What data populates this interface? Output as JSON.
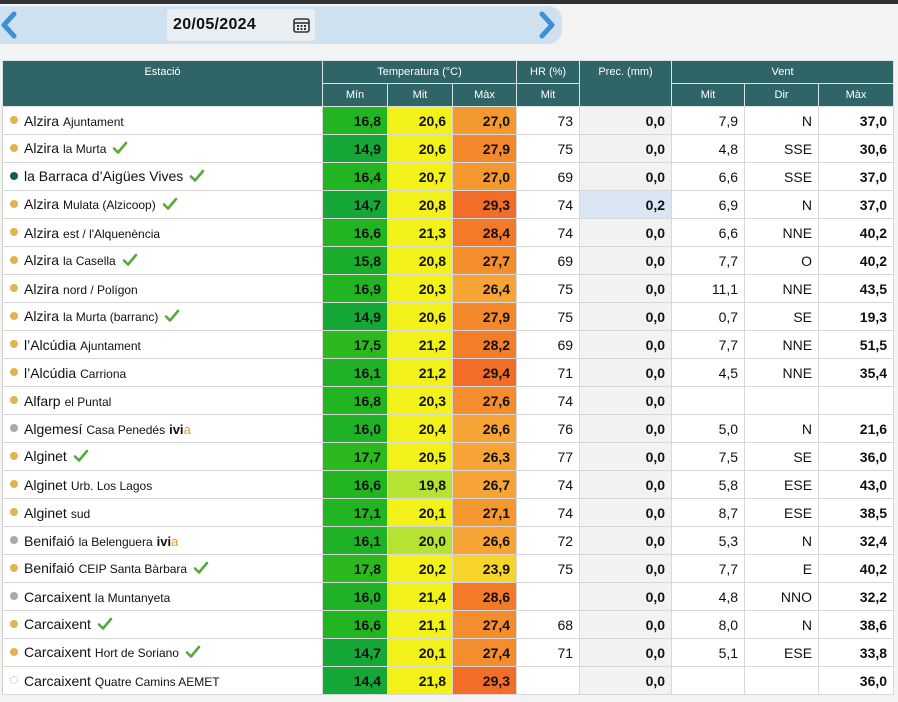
{
  "date": "20/05/2024",
  "colors": {
    "dot_yellow": "#e0b54a",
    "dot_teal": "#165c5b",
    "dot_gray": "#a8a8a8",
    "dot_white": "#ffffff",
    "check": "#58a83a",
    "header_bg": "#2f6566",
    "arrow": "#3c8fd8"
  },
  "header": {
    "estacio": "Estació",
    "temperatura": "Temperatura (°C)",
    "hr": "HR (%)",
    "prec": "Prec. (mm)",
    "vent": "Vent",
    "min": "Mín",
    "mit": "Mit",
    "max": "Màx",
    "hr_mit": "Mit",
    "vent_mit": "Mit",
    "vent_dir": "Dir",
    "vent_max": "Màx"
  },
  "rows": [
    {
      "name": "Alzira",
      "sub": "Ajuntament",
      "dot": "yellow",
      "check": false,
      "ivi": false,
      "tmin": "16,8",
      "tmit": "20,6",
      "tmax": "27,0",
      "hr": "73",
      "prec": "0,0",
      "vmit": "7,9",
      "vdir": "N",
      "vmax": "37,0",
      "c_min": "#23b521",
      "c_mit": "#f2f21a",
      "c_max": "#f49830"
    },
    {
      "name": "Alzira",
      "sub": "la Murta",
      "dot": "yellow",
      "check": true,
      "ivi": false,
      "tmin": "14,9",
      "tmit": "20,6",
      "tmax": "27,9",
      "hr": "75",
      "prec": "0,0",
      "vmit": "4,8",
      "vdir": "SSE",
      "vmax": "30,6",
      "c_min": "#15a836",
      "c_mit": "#f2f21a",
      "c_max": "#f3892c"
    },
    {
      "name": "la Barraca d’Aigües Vives",
      "sub": "",
      "dot": "teal",
      "check": true,
      "ivi": false,
      "tmin": "16,4",
      "tmit": "20,7",
      "tmax": "27,0",
      "hr": "69",
      "prec": "0,0",
      "vmit": "6,6",
      "vdir": "SSE",
      "vmax": "37,0",
      "c_min": "#23b521",
      "c_mit": "#f2f21a",
      "c_max": "#f49830"
    },
    {
      "name": "Alzira",
      "sub": "Mulata (Alzicoop)",
      "dot": "yellow",
      "check": true,
      "ivi": false,
      "tmin": "14,7",
      "tmit": "20,8",
      "tmax": "29,3",
      "hr": "74",
      "prec": "0,2",
      "vmit": "6,9",
      "vdir": "N",
      "vmax": "37,0",
      "c_min": "#15a836",
      "c_mit": "#f2f21a",
      "c_max": "#f26d27",
      "hl": true
    },
    {
      "name": "Alzira",
      "sub": "est / l'Alquenència",
      "dot": "yellow",
      "check": false,
      "ivi": false,
      "tmin": "16,6",
      "tmit": "21,3",
      "tmax": "28,4",
      "hr": "74",
      "prec": "0,0",
      "vmit": "6,6",
      "vdir": "NNE",
      "vmax": "40,2",
      "c_min": "#23b521",
      "c_mit": "#f2f21a",
      "c_max": "#f37a29"
    },
    {
      "name": "Alzira",
      "sub": "la Casella",
      "dot": "yellow",
      "check": true,
      "ivi": false,
      "tmin": "15,8",
      "tmit": "20,8",
      "tmax": "27,7",
      "hr": "69",
      "prec": "0,0",
      "vmit": "7,7",
      "vdir": "O",
      "vmax": "40,2",
      "c_min": "#1aad2a",
      "c_mit": "#f2f21a",
      "c_max": "#f38d2d"
    },
    {
      "name": "Alzira",
      "sub": "nord / Polígon",
      "dot": "yellow",
      "check": false,
      "ivi": false,
      "tmin": "16,9",
      "tmit": "20,3",
      "tmax": "26,4",
      "hr": "75",
      "prec": "0,0",
      "vmit": "11,1",
      "vdir": "NNE",
      "vmax": "43,5",
      "c_min": "#23b521",
      "c_mit": "#f2f21a",
      "c_max": "#f5a435"
    },
    {
      "name": "Alzira",
      "sub": "la Murta (barranc)",
      "dot": "yellow",
      "check": true,
      "ivi": false,
      "tmin": "14,9",
      "tmit": "20,6",
      "tmax": "27,9",
      "hr": "75",
      "prec": "0,0",
      "vmit": "0,7",
      "vdir": "SE",
      "vmax": "19,3",
      "c_min": "#15a836",
      "c_mit": "#f2f21a",
      "c_max": "#f3892c"
    },
    {
      "name": "l’Alcúdia",
      "sub": "Ajuntament",
      "dot": "yellow",
      "check": false,
      "ivi": false,
      "tmin": "17,5",
      "tmit": "21,2",
      "tmax": "28,2",
      "hr": "69",
      "prec": "0,0",
      "vmit": "7,7",
      "vdir": "NNE",
      "vmax": "51,5",
      "c_min": "#2bb91f",
      "c_mit": "#f2f21a",
      "c_max": "#f37e2a"
    },
    {
      "name": "l’Alcúdia",
      "sub": "Carriona",
      "dot": "yellow",
      "check": false,
      "ivi": false,
      "tmin": "16,1",
      "tmit": "21,2",
      "tmax": "29,4",
      "hr": "71",
      "prec": "0,0",
      "vmit": "4,5",
      "vdir": "NNE",
      "vmax": "35,4",
      "c_min": "#1fb126",
      "c_mit": "#f2f21a",
      "c_max": "#f26d27"
    },
    {
      "name": "Alfarp",
      "sub": "el Puntal",
      "dot": "yellow",
      "check": false,
      "ivi": false,
      "tmin": "16,8",
      "tmit": "20,3",
      "tmax": "27,6",
      "hr": "74",
      "prec": "0,0",
      "vmit": "",
      "vdir": "",
      "vmax": "",
      "c_min": "#23b521",
      "c_mit": "#f2f21a",
      "c_max": "#f38d2d"
    },
    {
      "name": "Algemesí",
      "sub": "Casa Penedés",
      "dot": "gray",
      "check": false,
      "ivi": true,
      "tmin": "16,0",
      "tmit": "20,4",
      "tmax": "26,6",
      "hr": "76",
      "prec": "0,0",
      "vmit": "5,0",
      "vdir": "N",
      "vmax": "21,6",
      "c_min": "#1fb126",
      "c_mit": "#f2f21a",
      "c_max": "#f5a435"
    },
    {
      "name": "Alginet",
      "sub": "",
      "dot": "yellow",
      "check": true,
      "ivi": false,
      "tmin": "17,7",
      "tmit": "20,5",
      "tmax": "26,3",
      "hr": "77",
      "prec": "0,0",
      "vmit": "7,5",
      "vdir": "SE",
      "vmax": "36,0",
      "c_min": "#2bb91f",
      "c_mit": "#f2f21a",
      "c_max": "#f5a435"
    },
    {
      "name": "Alginet",
      "sub": "Urb. Los Lagos",
      "dot": "yellow",
      "check": false,
      "ivi": false,
      "tmin": "16,6",
      "tmit": "19,8",
      "tmax": "26,7",
      "hr": "74",
      "prec": "0,0",
      "vmit": "5,8",
      "vdir": "ESE",
      "vmax": "43,0",
      "c_min": "#23b521",
      "c_mit": "#b6e234",
      "c_max": "#f5a435"
    },
    {
      "name": "Alginet",
      "sub": "sud",
      "dot": "yellow",
      "check": false,
      "ivi": false,
      "tmin": "17,1",
      "tmit": "20,1",
      "tmax": "27,1",
      "hr": "74",
      "prec": "0,0",
      "vmit": "8,7",
      "vdir": "ESE",
      "vmax": "38,5",
      "c_min": "#23b521",
      "c_mit": "#f2f21a",
      "c_max": "#f49830"
    },
    {
      "name": "Benifaió",
      "sub": "la Belenguera",
      "dot": "gray",
      "check": false,
      "ivi": true,
      "tmin": "16,1",
      "tmit": "20,0",
      "tmax": "26,6",
      "hr": "72",
      "prec": "0,0",
      "vmit": "5,3",
      "vdir": "N",
      "vmax": "32,4",
      "c_min": "#1fb126",
      "c_mit": "#b6e234",
      "c_max": "#f5a435"
    },
    {
      "name": "Benifaió",
      "sub": "CEIP Santa Bàrbara",
      "dot": "yellow",
      "check": true,
      "ivi": false,
      "tmin": "17,8",
      "tmit": "20,2",
      "tmax": "23,9",
      "hr": "75",
      "prec": "0,0",
      "vmit": "7,7",
      "vdir": "E",
      "vmax": "40,2",
      "c_min": "#2bb91f",
      "c_mit": "#f2f21a",
      "c_max": "#f6d42a"
    },
    {
      "name": "Carcaixent",
      "sub": "la Muntanyeta",
      "dot": "gray",
      "check": false,
      "ivi": false,
      "tmin": "16,0",
      "tmit": "21,4",
      "tmax": "28,6",
      "hr": "",
      "prec": "0,0",
      "vmit": "4,8",
      "vdir": "NNO",
      "vmax": "32,2",
      "c_min": "#1fb126",
      "c_mit": "#f2f21a",
      "c_max": "#f37a29"
    },
    {
      "name": "Carcaixent",
      "sub": "",
      "dot": "yellow",
      "check": true,
      "ivi": false,
      "tmin": "16,6",
      "tmit": "21,1",
      "tmax": "27,4",
      "hr": "68",
      "prec": "0,0",
      "vmit": "8,0",
      "vdir": "N",
      "vmax": "38,6",
      "c_min": "#23b521",
      "c_mit": "#f2f21a",
      "c_max": "#f38d2d"
    },
    {
      "name": "Carcaixent",
      "sub": "Hort de Soriano",
      "dot": "yellow",
      "check": true,
      "ivi": false,
      "tmin": "14,7",
      "tmit": "20,1",
      "tmax": "27,4",
      "hr": "71",
      "prec": "0,0",
      "vmit": "5,1",
      "vdir": "ESE",
      "vmax": "33,8",
      "c_min": "#15a836",
      "c_mit": "#f2f21a",
      "c_max": "#f38d2d"
    },
    {
      "name": "Carcaixent",
      "sub": "Quatre Camins AEMET",
      "dot": "white",
      "check": false,
      "ivi": false,
      "tmin": "14,4",
      "tmit": "21,8",
      "tmax": "29,3",
      "hr": "",
      "prec": "0,0",
      "vmit": "",
      "vdir": "",
      "vmax": "36,0",
      "c_min": "#15a836",
      "c_mit": "#f2f21a",
      "c_max": "#f26d27"
    }
  ],
  "ivi": {
    "text": "ivi",
    "accent": "a"
  }
}
